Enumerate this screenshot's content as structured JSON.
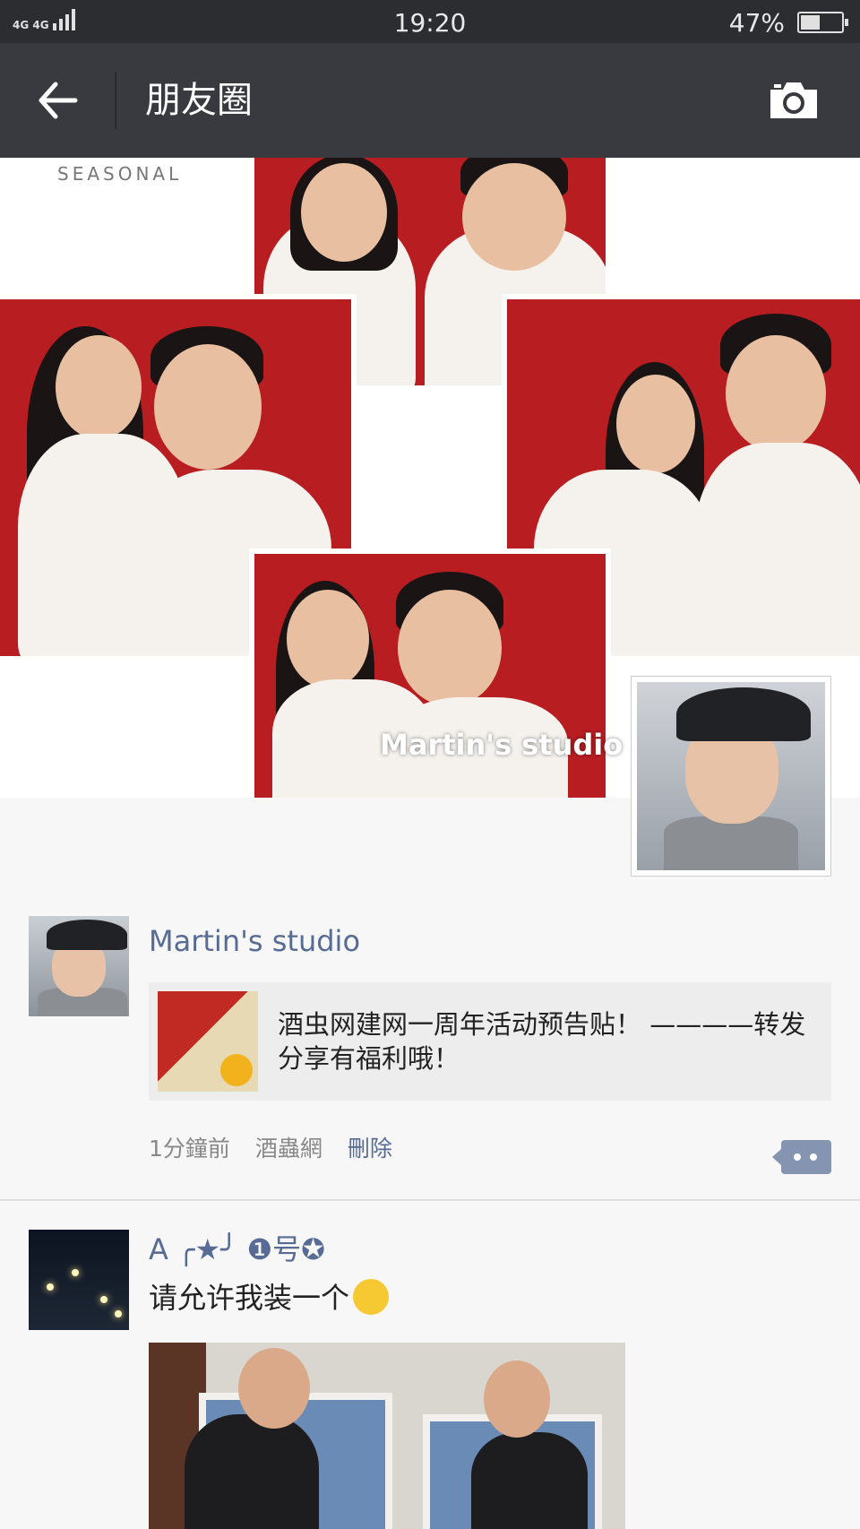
{
  "status_bar": {
    "network": "4G 4G",
    "time": "19:20",
    "battery_percent_label": "47%",
    "battery_level": 0.47
  },
  "nav": {
    "back_icon": "arrow-left-icon",
    "title": "朋友圈",
    "camera_icon": "camera-icon"
  },
  "cover": {
    "seasonal_text": "SEASONAL",
    "watermark": "Martin's studio",
    "accent_color": "#b81d22"
  },
  "posts": [
    {
      "author": "Martin's studio",
      "link_text": "酒虫网建网一周年活动预告贴！ ————转发分享有福利哦！",
      "time": "1分鐘前",
      "source": "酒蟲網",
      "delete_label": "刪除"
    },
    {
      "author": "A ╭★╯ ❶号✪",
      "status_text": "请允许我装一个"
    }
  ],
  "colors": {
    "name_link": "#576b95",
    "nav_bg": "#393a3f",
    "status_bg": "#2c2d31"
  }
}
